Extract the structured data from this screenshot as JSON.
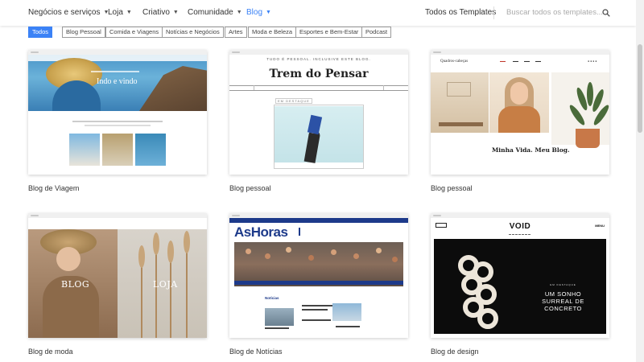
{
  "nav": {
    "items": [
      {
        "label": "Negócios e serviços"
      },
      {
        "label": "Loja"
      },
      {
        "label": "Criativo"
      },
      {
        "label": "Comunidade"
      },
      {
        "label": "Blog"
      }
    ],
    "active_item": "Blog",
    "all_templates": "Todos os Templates",
    "search_placeholder": "Buscar todos os templates..."
  },
  "filters": [
    {
      "label": "Todos",
      "active": true
    },
    {
      "label": "Blog Pessoal"
    },
    {
      "label": "Comida e Viagens"
    },
    {
      "label": "Notícias e Negócios"
    },
    {
      "label": "Artes"
    },
    {
      "label": "Moda e Beleza"
    },
    {
      "label": "Esportes e Bem-Estar"
    },
    {
      "label": "Podcast"
    }
  ],
  "templates": [
    {
      "label": "Blog de Viagem",
      "hero_title": "Indo e vindo"
    },
    {
      "label": "Blog pessoal",
      "kicker": "TUDO É PESSOAL. INCLUSIVE ESTE BLOG.",
      "hero_title": "Trem do Pensar",
      "tag": "EM DESTAQUE"
    },
    {
      "label": "Blog pessoal",
      "logo": "Quadros-cabeças",
      "caption": "Minha Vida. Meu Blog."
    },
    {
      "label": "Blog de moda",
      "left_word": "BLOG",
      "right_word": "LOJA"
    },
    {
      "label": "Blog de Notícias",
      "logo": "AsHoras",
      "section": "Notícias"
    },
    {
      "label": "Blog de design",
      "logo": "VOID",
      "menu": "MENU",
      "kicker": "EM DESTAQUE",
      "headline_1": "UM SONHO",
      "headline_2": "SURREAL DE",
      "headline_3": "CONCRETO"
    }
  ],
  "colors": {
    "accent": "#3b82f6",
    "news_blue": "#1d3a8a"
  }
}
